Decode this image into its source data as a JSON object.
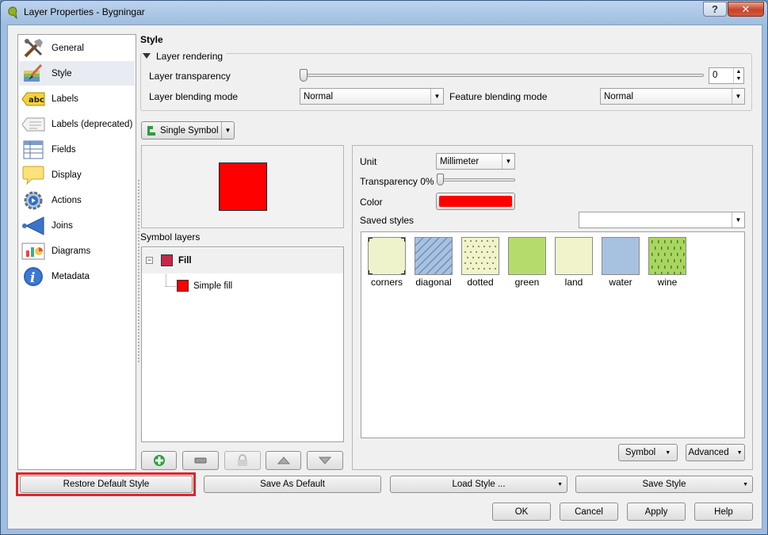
{
  "window": {
    "title": "Layer Properties - Bygningar",
    "help_label": "?",
    "close_label": "✕"
  },
  "nav": {
    "items": [
      {
        "label": "General",
        "icon": "tools-icon"
      },
      {
        "label": "Style",
        "icon": "paintbrush-icon"
      },
      {
        "label": "Labels",
        "icon": "abc-label-icon"
      },
      {
        "label": "Labels (deprecated)",
        "icon": "label-deprecated-icon"
      },
      {
        "label": "Fields",
        "icon": "table-icon"
      },
      {
        "label": "Display",
        "icon": "speech-bubble-icon"
      },
      {
        "label": "Actions",
        "icon": "gear-play-icon"
      },
      {
        "label": "Joins",
        "icon": "join-arrow-icon"
      },
      {
        "label": "Diagrams",
        "icon": "diagram-icon"
      },
      {
        "label": "Metadata",
        "icon": "info-icon"
      }
    ],
    "selected": "Style"
  },
  "style": {
    "title": "Style",
    "rendering": {
      "label": "Layer rendering",
      "transparency_label": "Layer transparency",
      "transparency_value": "0",
      "transparency_fraction": 0,
      "blending_label": "Layer blending mode",
      "blending_value": "Normal",
      "feature_blending_label": "Feature blending mode",
      "feature_blending_value": "Normal"
    },
    "renderer": "Single Symbol",
    "preview_color": "#ff0000",
    "symbol_layers_label": "Symbol layers",
    "tree": {
      "root": "Fill",
      "child": "Simple fill",
      "root_color": "#c8264a",
      "child_color": "#ff0000"
    },
    "props": {
      "unit_label": "Unit",
      "unit_value": "Millimeter",
      "transparency_label": "Transparency 0%",
      "transparency_fraction": 0,
      "color_label": "Color",
      "color_value": "#ff0000",
      "saved_styles_label": "Saved styles",
      "saved_styles_value": ""
    },
    "swatches": [
      {
        "label": "corners",
        "color": "#eff3cc"
      },
      {
        "label": "diagonal",
        "color": "#a7c1e1"
      },
      {
        "label": "dotted",
        "color": "#f1f3cb"
      },
      {
        "label": "green",
        "color": "#b5dc6b"
      },
      {
        "label": "land",
        "color": "#f1f3cb"
      },
      {
        "label": "water",
        "color": "#a7c1e1"
      },
      {
        "label": "wine",
        "color": "#a8d660"
      }
    ],
    "symbol_button": "Symbol",
    "advanced_button": "Advanced"
  },
  "footer": {
    "restore": "Restore Default Style",
    "save_default": "Save As Default",
    "load_style": "Load Style ...",
    "save_style": "Save Style",
    "ok": "OK",
    "cancel": "Cancel",
    "apply": "Apply",
    "help": "Help"
  },
  "colors": {
    "highlight": "#e0242c"
  }
}
